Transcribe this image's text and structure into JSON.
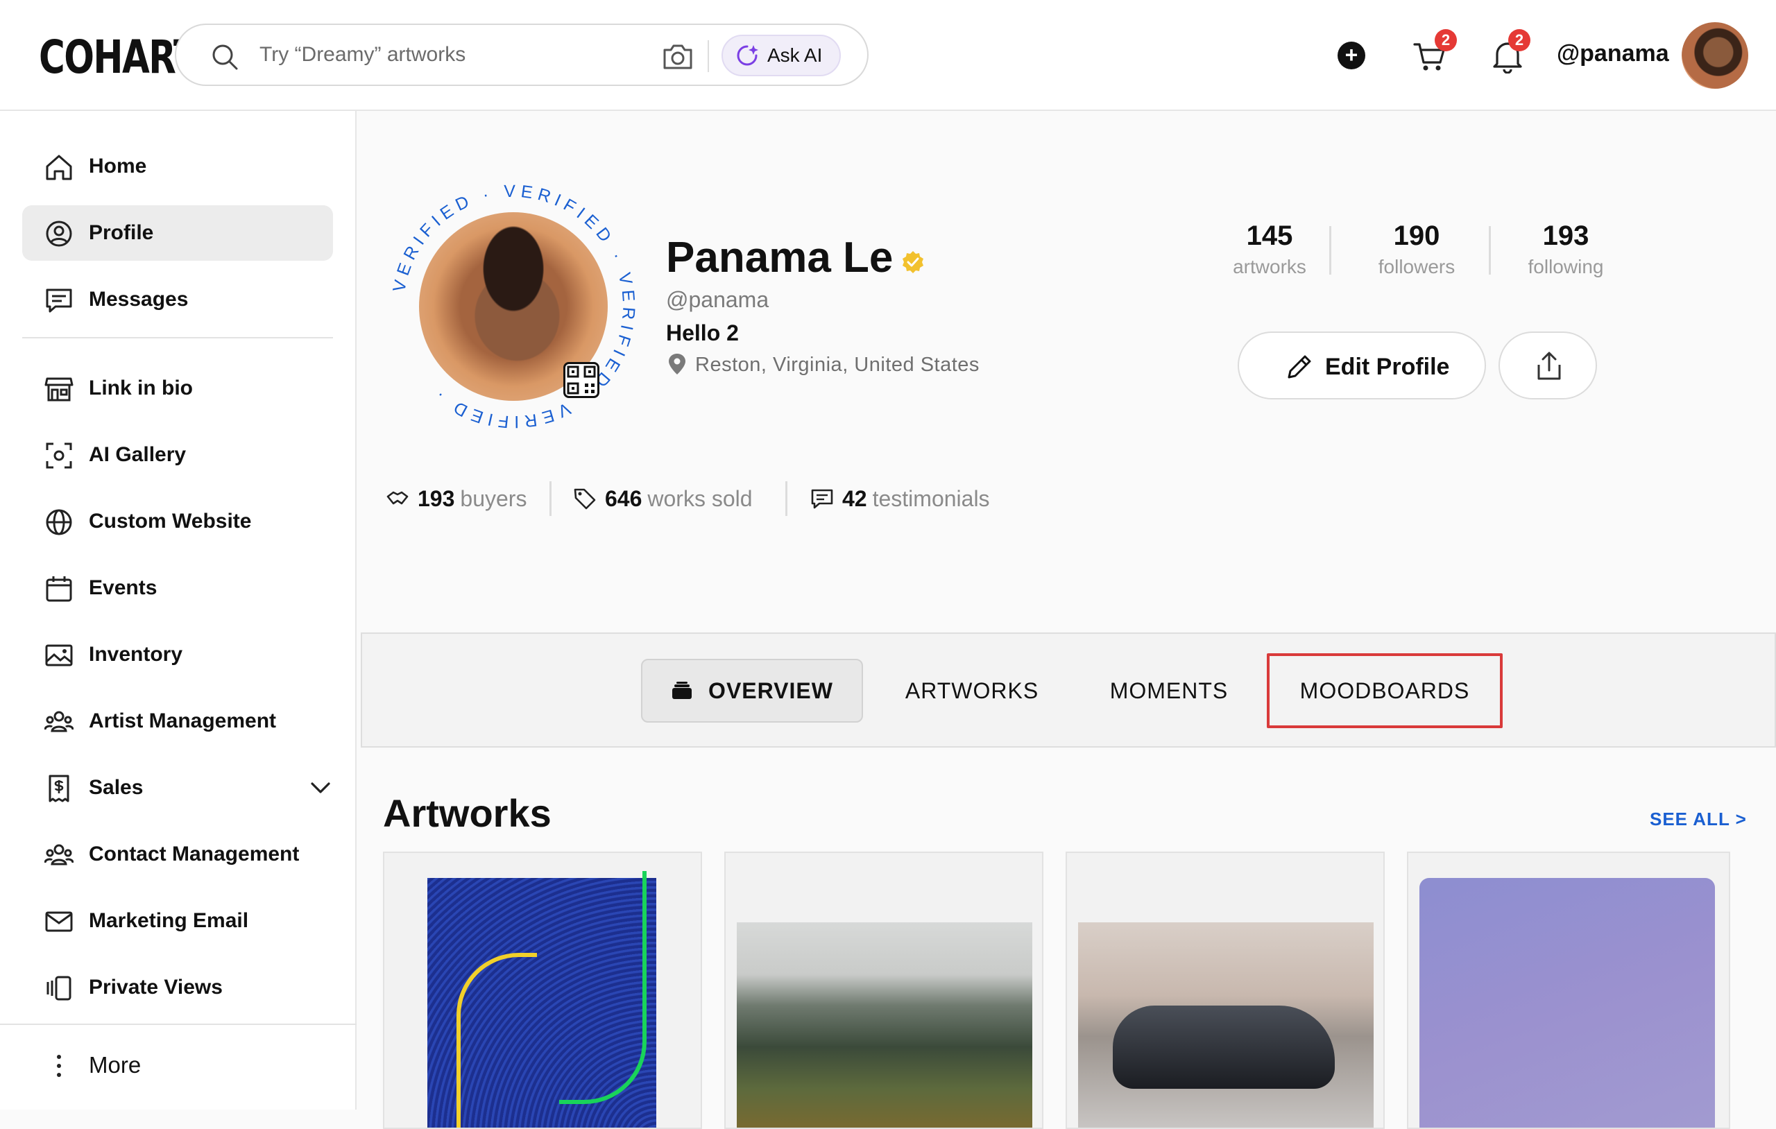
{
  "app": {
    "logo": "COHART"
  },
  "search": {
    "placeholder": "Try “Dreamy” artworks",
    "ask_ai_label": "Ask AI"
  },
  "header": {
    "cart_badge": "2",
    "notif_badge": "2",
    "user_handle": "@panama"
  },
  "sidebar": {
    "items": [
      {
        "label": "Home"
      },
      {
        "label": "Profile"
      },
      {
        "label": "Messages"
      },
      {
        "label": "Link in bio"
      },
      {
        "label": "AI Gallery"
      },
      {
        "label": "Custom Website"
      },
      {
        "label": "Events"
      },
      {
        "label": "Inventory"
      },
      {
        "label": "Artist Management"
      },
      {
        "label": "Sales"
      },
      {
        "label": "Contact Management"
      },
      {
        "label": "Marketing Email"
      },
      {
        "label": "Private Views"
      }
    ],
    "more_label": "More"
  },
  "profile": {
    "ring_text": "VERIFIED · VERIFIED · VERIFIED · VERIFIED ·",
    "name": "Panama Le",
    "handle": "@panama",
    "bio": "Hello 2",
    "location": "Reston, Virginia, United States",
    "stats": [
      {
        "value": "145",
        "label": "artworks"
      },
      {
        "value": "190",
        "label": "followers"
      },
      {
        "value": "193",
        "label": "following"
      }
    ],
    "edit_label": "Edit Profile",
    "sales": [
      {
        "value": "193",
        "label": "buyers"
      },
      {
        "value": "646",
        "label": "works sold"
      },
      {
        "value": "42",
        "label": "testimonials"
      }
    ]
  },
  "tabs": [
    {
      "label": "OVERVIEW"
    },
    {
      "label": "ARTWORKS"
    },
    {
      "label": "MOMENTS"
    },
    {
      "label": "MOODBOARDS"
    }
  ],
  "artworks": {
    "title": "Artworks",
    "see_all": "SEE ALL >"
  },
  "colors": {
    "accent_link": "#1a5fd1",
    "badge": "#e53935",
    "verified_ring": "#1a5fd1",
    "verified_check": "#f2c12e",
    "highlight_box": "#d93a3a"
  }
}
